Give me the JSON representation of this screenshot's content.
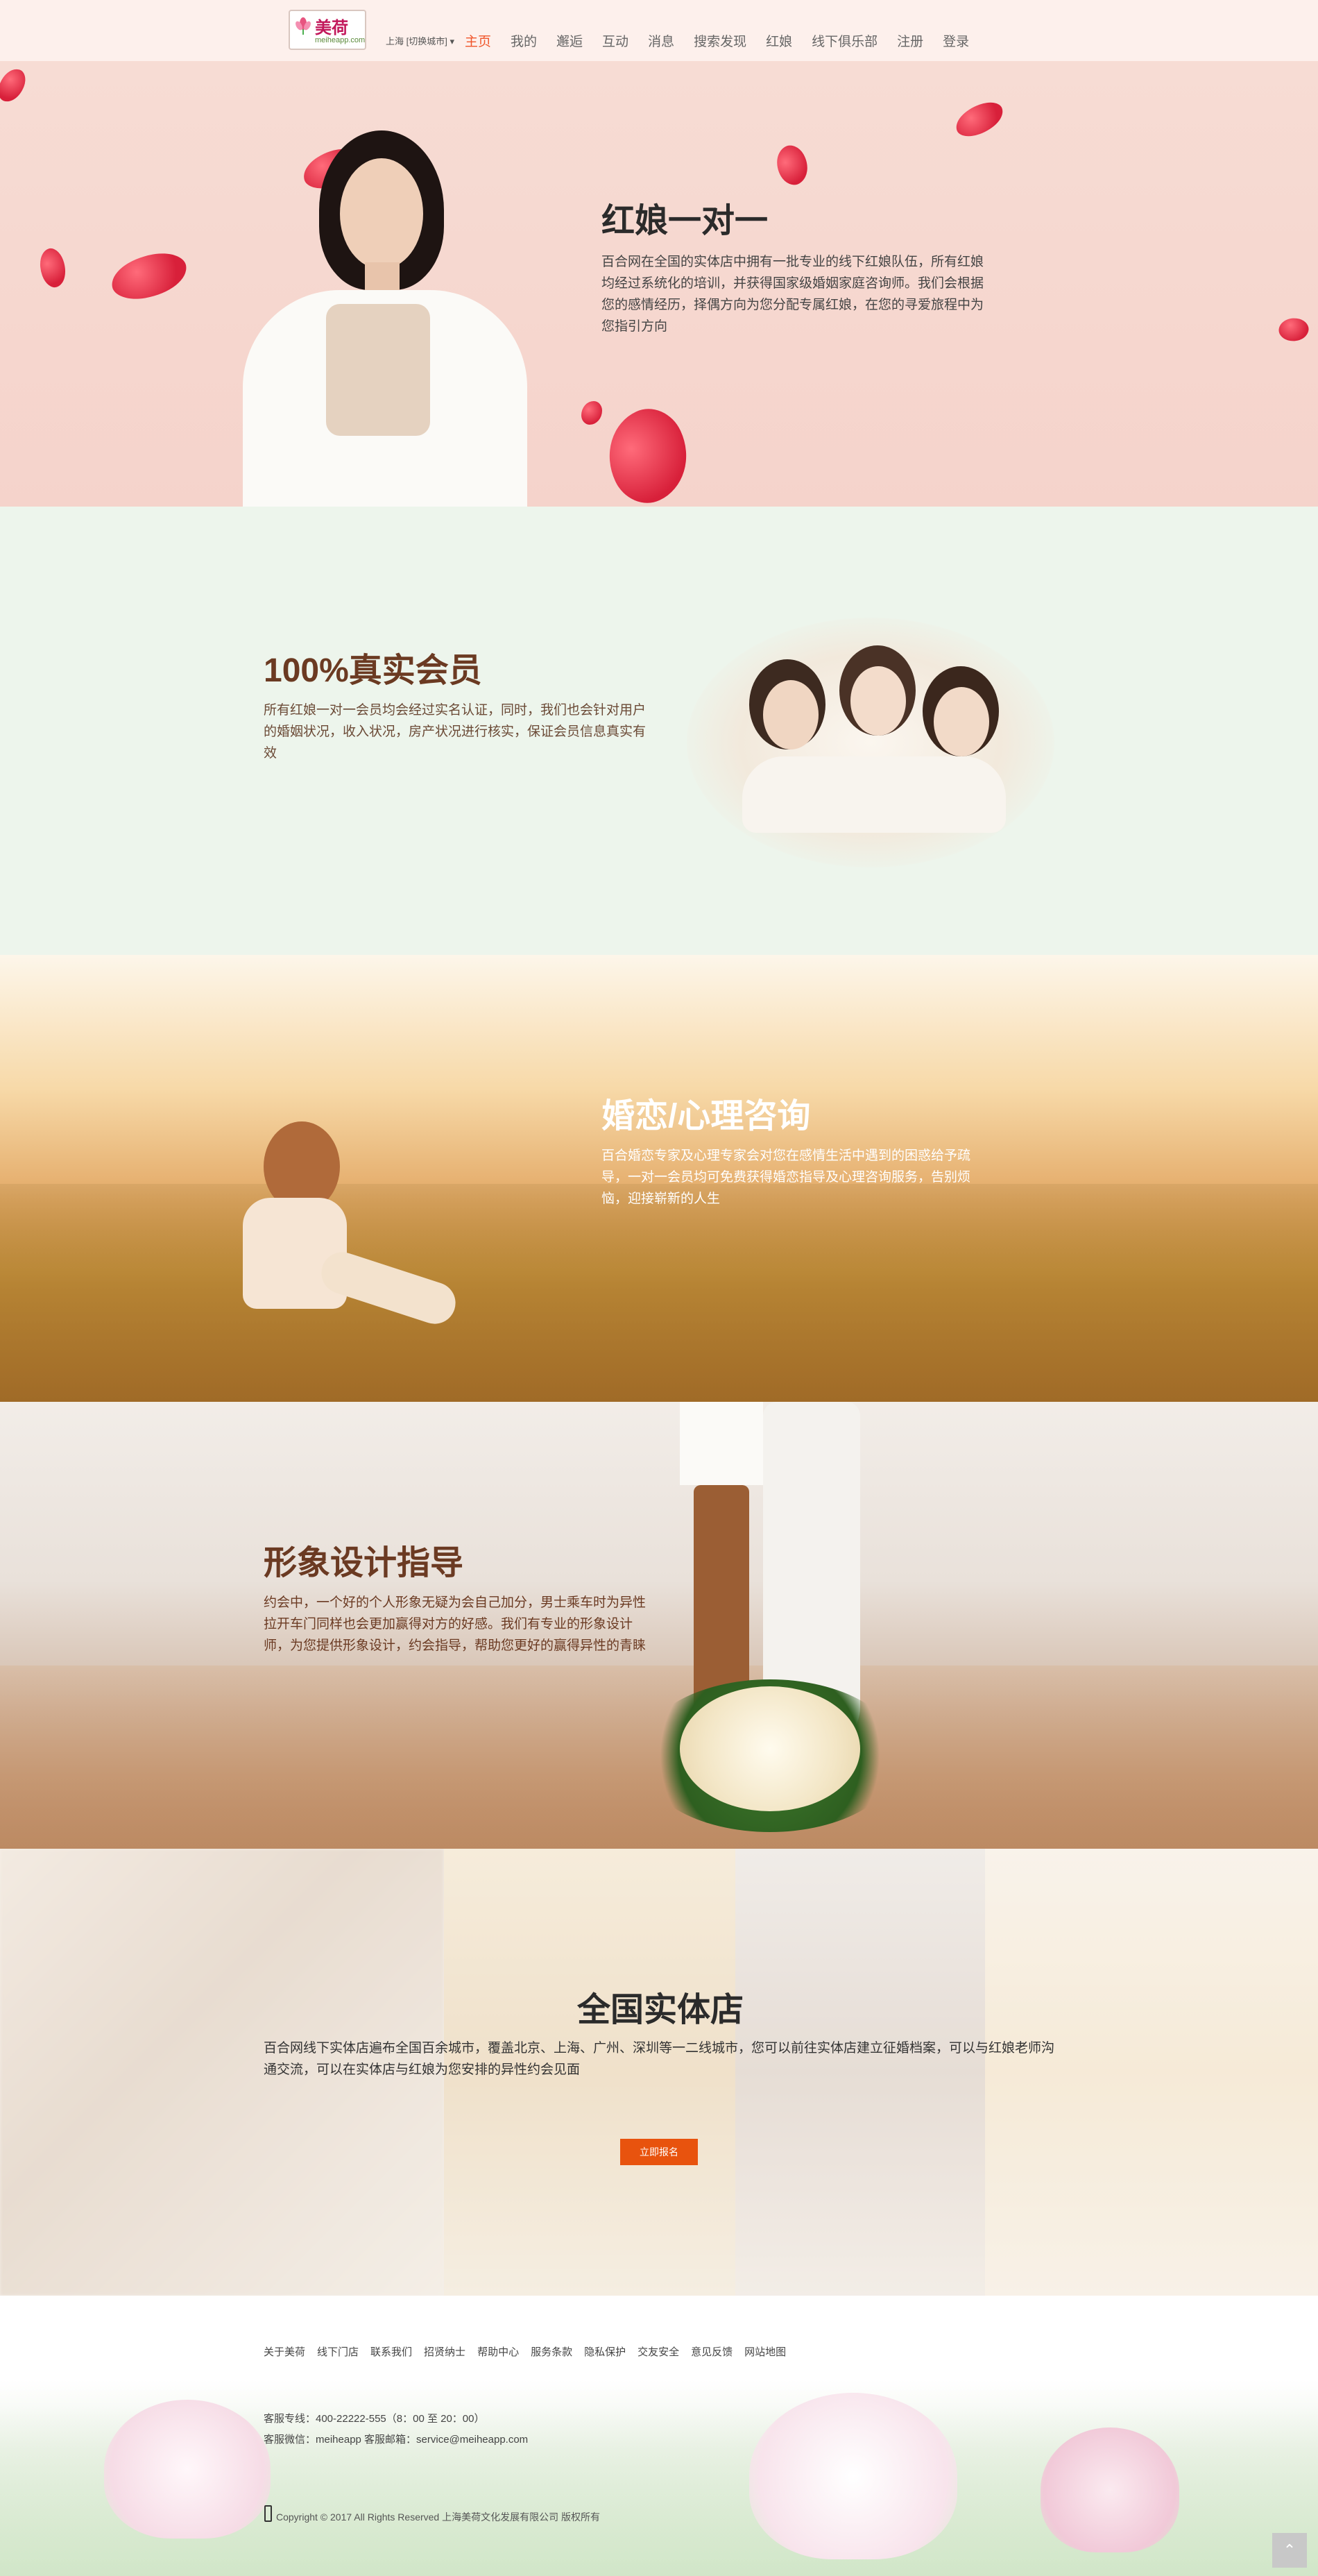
{
  "nav": {
    "logo_name": "美荷",
    "logo_domain": "meiheapp.com",
    "city": "上海 [切换城市] ▾",
    "items": [
      "主页",
      "我的",
      "邂逅",
      "互动",
      "消息",
      "搜索发现",
      "红娘",
      "线下俱乐部",
      "注册",
      "登录"
    ]
  },
  "sections": {
    "matchmaker": {
      "title": "红娘一对一",
      "desc": "百合网在全国的实体店中拥有一批专业的线下红娘队伍，所有红娘均经过系统化的培训，并获得国家级婚姻家庭咨询师。我们会根据您的感情经历，择偶方向为您分配专属红娘，在您的寻爱旅程中为您指引方向"
    },
    "members": {
      "title": "100%真实会员",
      "desc": "所有红娘一对一会员均会经过实名认证，同时，我们也会针对用户的婚姻状况，收入状况，房产状况进行核实，保证会员信息真实有效"
    },
    "counseling": {
      "title": "婚恋/心理咨询",
      "desc": "百合婚恋专家及心理专家会对您在感情生活中遇到的困惑给予疏导，一对一会员均可免费获得婚恋指导及心理咨询服务，告别烦恼，迎接崭新的人生"
    },
    "image": {
      "title": "形象设计指导",
      "desc": "约会中，一个好的个人形象无疑为会自己加分，男士乘车时为异性拉开车门同样也会更加赢得对方的好感。我们有专业的形象设计师，为您提供形象设计，约会指导，帮助您更好的赢得异性的青睐"
    },
    "stores": {
      "title": "全国实体店",
      "desc": "百合网线下实体店遍布全国百余城市，覆盖北京、上海、广州、深圳等一二线城市，您可以前往实体店建立征婚档案，可以与红娘老师沟通交流，可以在实体店与红娘为您安排的异性约会见面",
      "cta": "立即报名"
    }
  },
  "footer": {
    "links": [
      "关于美荷",
      "线下门店",
      "联系我们",
      "招贤纳士",
      "帮助中心",
      "服务条款",
      "隐私保护",
      "交友安全",
      "意见反馈",
      "网站地图"
    ],
    "hotline": "客服专线：400-22222-555（8：00 至 20：00）",
    "wechat": "客服微信：meiheapp 客服邮箱：service@meiheapp.com",
    "copyright": "Copyright © 2017 All Rights Reserved 上海美荷文化发展有限公司 版权所有",
    "top_button": "⌃"
  },
  "colors": {
    "accent": "#f0562b",
    "cta": "#e8530e",
    "title_brown": "#6b3a22"
  }
}
